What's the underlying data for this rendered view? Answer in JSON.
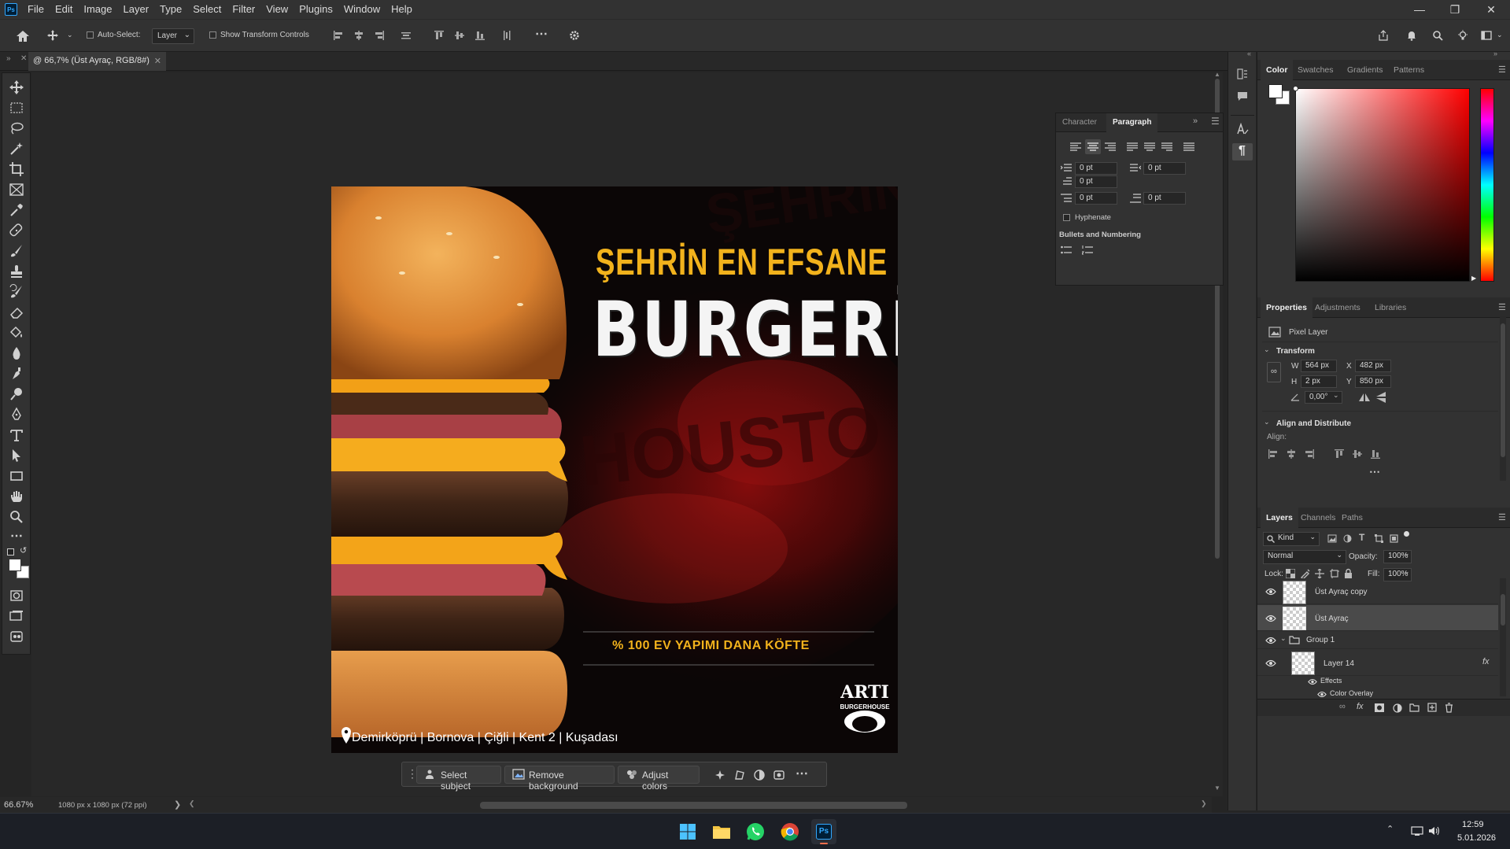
{
  "app": {
    "menus": [
      "File",
      "Edit",
      "Image",
      "Layer",
      "Type",
      "Select",
      "Filter",
      "View",
      "Plugins",
      "Window",
      "Help"
    ],
    "logo_text": "Ps"
  },
  "options_bar": {
    "auto_select_label": "Auto-Select:",
    "auto_select_target": "Layer",
    "show_transform_label": "Show Transform Controls"
  },
  "document": {
    "tab_title": "@ 66,7% (Üst Ayraç, RGB/8#)",
    "zoom": "66.67%",
    "doc_info": "1080 px x 1080 px (72 ppi)"
  },
  "artwork": {
    "headline_line1": "ŞEHRİN EN EFSANE",
    "headline_line2": "BURGERİ",
    "tagline": "% 100 EV YAPIMI DANA KÖFTE",
    "address": "Demirköprü | Bornova | Çiğli | Kent 2 | Kuşadası",
    "logo_text_top": "ARTI",
    "logo_text_bottom": "BURGERHOUSE",
    "accent_color": "#f2b21c"
  },
  "contextual_bar": {
    "select_subject": "Select subject",
    "remove_background": "Remove background",
    "adjust_colors": "Adjust colors"
  },
  "paragraph_panel": {
    "tabs": [
      "Character",
      "Paragraph"
    ],
    "active_tab": "Paragraph",
    "indent_left": "0 pt",
    "indent_right": "0 pt",
    "indent_first": "0 pt",
    "space_before": "0 pt",
    "space_after": "0 pt",
    "hyphenate_label": "Hyphenate",
    "bullets_label": "Bullets and Numbering"
  },
  "color_panel": {
    "tabs": [
      "Color",
      "Swatches",
      "Gradients",
      "Patterns"
    ],
    "active_tab": "Color",
    "hue_color": "#ff0000"
  },
  "properties_panel": {
    "tabs": [
      "Properties",
      "Adjustments",
      "Libraries"
    ],
    "active_tab": "Properties",
    "layer_type": "Pixel Layer",
    "transform_title": "Transform",
    "w_label": "W",
    "w_value": "564 px",
    "h_label": "H",
    "h_value": "2 px",
    "x_label": "X",
    "x_value": "482 px",
    "y_label": "Y",
    "y_value": "850 px",
    "angle_value": "0,00°",
    "align_title": "Align and Distribute",
    "align_label": "Align:"
  },
  "layers_panel": {
    "tabs": [
      "Layers",
      "Channels",
      "Paths"
    ],
    "active_tab": "Layers",
    "filter_kind": "Kind",
    "blend_mode": "Normal",
    "opacity_label": "Opacity:",
    "opacity_value": "100%",
    "lock_label": "Lock:",
    "fill_label": "Fill:",
    "fill_value": "100%",
    "layers": [
      {
        "name": "Üst Ayraç copy"
      },
      {
        "name": "Üst Ayraç"
      },
      {
        "name": "Group 1"
      },
      {
        "name": "Layer 14"
      },
      {
        "name": "Effects"
      },
      {
        "name": "Color Overlay"
      }
    ]
  },
  "taskbar": {
    "time": "12:59",
    "date": "5.01.2026",
    "ps_label": "Ps"
  }
}
